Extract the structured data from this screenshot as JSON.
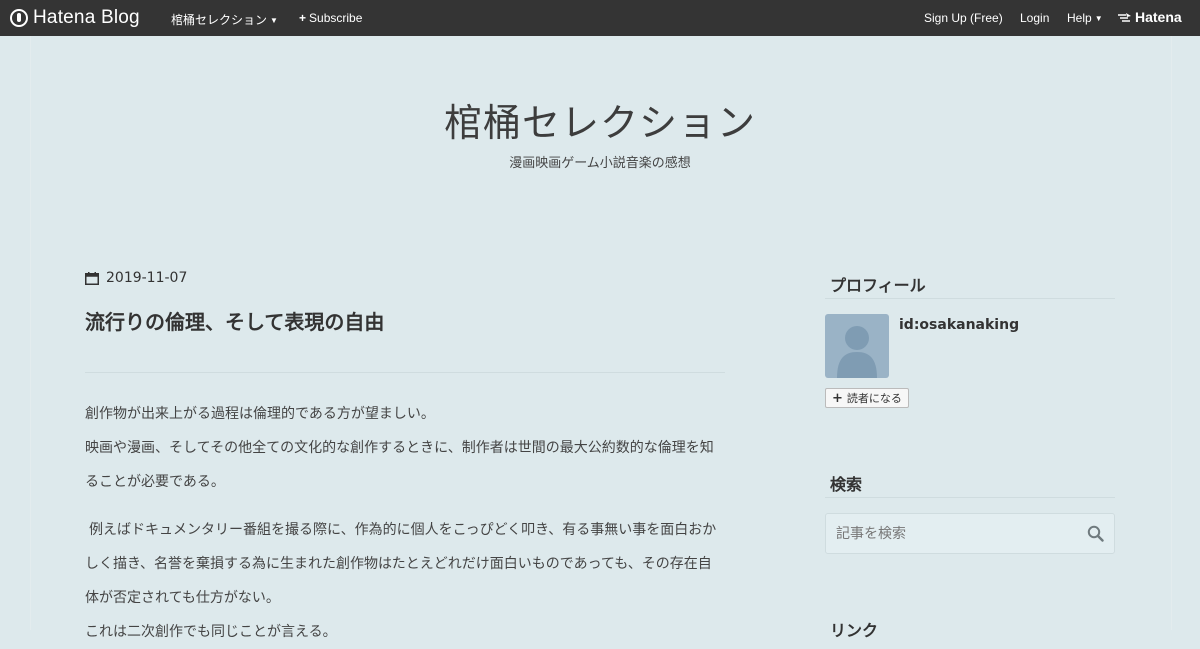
{
  "topbar": {
    "brand": "Hatena Blog",
    "blog_menu": "棺桶セレクション",
    "subscribe": "Subscribe",
    "signup": "Sign Up (Free)",
    "login": "Login",
    "help": "Help",
    "hatena": "Hatena"
  },
  "blog": {
    "title": "棺桶セレクション",
    "description": "漫画映画ゲーム小説音楽の感想"
  },
  "entry": {
    "date": "2019-11-07",
    "title": "流行りの倫理、そして表現の自由",
    "paragraphs": [
      "創作物が出来上がる過程は倫理的である方が望ましい。\n映画や漫画、そしてその他全ての文化的な創作するときに、制作者は世間の最大公約数的な倫理を知ることが必要である。",
      "例えばドキュメンタリー番組を撮る際に、作為的に個人をこっぴどく叩き、有る事無い事を面白おかしく描き、名誉を棄損する為に生まれた創作物はたとえどれだけ面白いものであっても、その存在自体が否定されても仕方がない。\nこれは二次創作でも同じことが言える。"
    ]
  },
  "sidebar": {
    "profile_heading": "プロフィール",
    "profile_id": "id:osakanaking",
    "reader_button": "読者になる",
    "search_heading": "検索",
    "search_placeholder": "記事を検索",
    "links_heading": "リンク"
  },
  "colors": {
    "topbar": "#343434",
    "background": "#dde9ec",
    "text": "#333333",
    "avatar": "#9ab3c6"
  }
}
